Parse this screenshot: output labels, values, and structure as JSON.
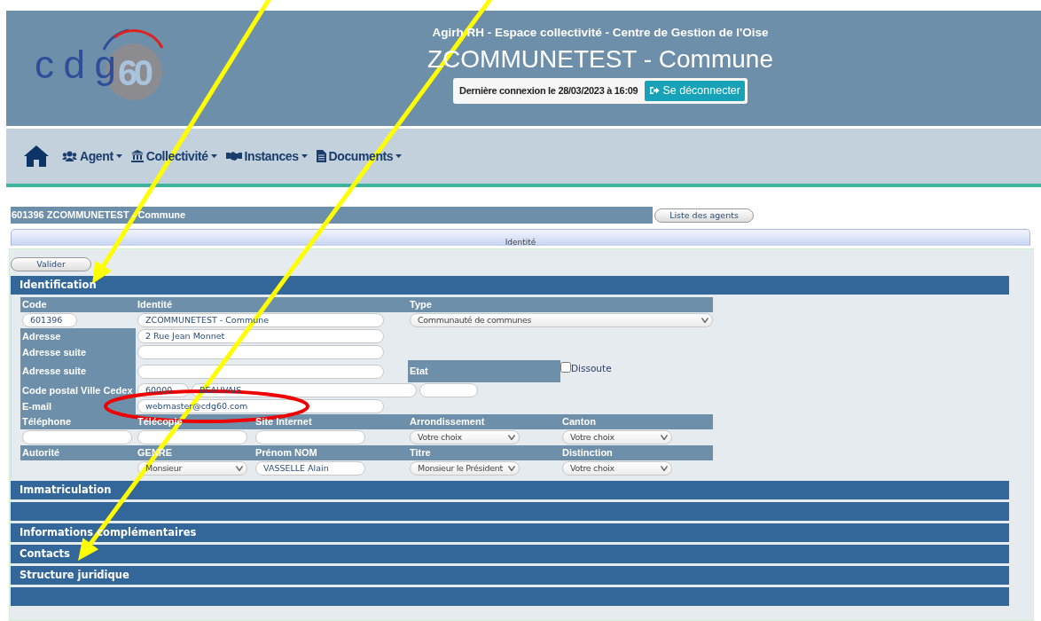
{
  "header": {
    "logo": {
      "letters": "cdg",
      "number": "60"
    },
    "subtitle": "Agirh RH - Espace collectivité - Centre de Gestion de l'Oise",
    "title": "ZCOMMUNETEST - Commune",
    "last_login": "Dernière connexion le 28/03/2023 à 16:09",
    "logout": "Se déconnecter"
  },
  "nav": [
    {
      "kind": "home"
    },
    {
      "kind": "users",
      "label": "Agent"
    },
    {
      "kind": "bank",
      "label": "Collectivité"
    },
    {
      "kind": "handshake",
      "label": "Instances"
    },
    {
      "kind": "document",
      "label": "Documents"
    }
  ],
  "record_title": "601396 ZCOMMUNETEST - Commune",
  "agents_button": "Liste des agents",
  "tab": {
    "label": "Identité",
    "selected": true
  },
  "validate_button": "Valider",
  "identification": {
    "title": "Identification",
    "code": {
      "label": "Code",
      "value": "601396"
    },
    "identity": {
      "label": "Identité",
      "value": "ZCOMMUNETEST - Commune"
    },
    "type": {
      "label": "Type",
      "value": "Communauté de communes"
    },
    "address": {
      "label": "Adresse",
      "value": "2 Rue Jean Monnet"
    },
    "address_lines": [
      {
        "label": "Adresse suite"
      },
      {
        "label": "Adresse suite"
      }
    ],
    "status": {
      "label": "Etat",
      "option": "Dissoute",
      "checked": false
    },
    "postal": {
      "label": "Code postal Ville Cedex",
      "postal_code": "60000",
      "city": "BEAUVAIS"
    },
    "email": {
      "label": "E-mail",
      "value": "webmaster@cdg60.com"
    },
    "contact": [
      {
        "label": "Téléphone",
        "kind": "input"
      },
      {
        "label": "Télécopie",
        "kind": "input"
      },
      {
        "label": "Site Internet",
        "kind": "input"
      },
      {
        "label": "Arrondissement",
        "kind": "select",
        "value": "Votre choix"
      },
      {
        "label": "Canton",
        "kind": "select",
        "value": "Votre choix"
      }
    ],
    "authority": {
      "label": "Autorité",
      "fields": [
        {
          "label": "GENRE",
          "kind": "select",
          "value": "Monsieur"
        },
        {
          "label": "Prénom NOM",
          "kind": "input",
          "value": "VASSELLE Alain"
        },
        {
          "label": "Titre",
          "kind": "select",
          "value": "Monsieur le Président"
        },
        {
          "label": "Distinction",
          "kind": "select",
          "value": "Votre choix"
        }
      ]
    }
  },
  "sections": [
    {
      "kind": "titled",
      "title": "Immatriculation"
    },
    {
      "kind": "blank"
    },
    {
      "kind": "titled",
      "title": "Informations complémentaires"
    },
    {
      "kind": "titled",
      "title": "Contacts"
    },
    {
      "kind": "titled",
      "title": "Structure juridique"
    },
    {
      "kind": "blank"
    }
  ],
  "annotations": [
    {
      "kind": "arrow"
    },
    {
      "kind": "arrow"
    },
    {
      "kind": "ellipse"
    }
  ]
}
